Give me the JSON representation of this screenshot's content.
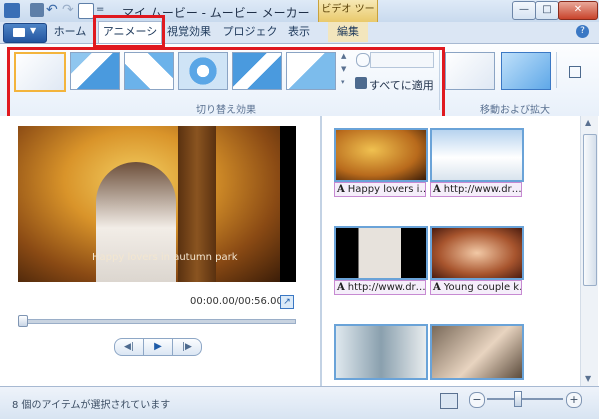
{
  "titlebar": {
    "title": "マイ ムービー - ムービー メーカー",
    "context_group": "ビデオ ツール"
  },
  "tabs": [
    {
      "id": "home",
      "label": "ホーム"
    },
    {
      "id": "animation",
      "label": "アニメーション"
    },
    {
      "id": "visual",
      "label": "視覚効果"
    },
    {
      "id": "project",
      "label": "プロジェクト"
    },
    {
      "id": "view",
      "label": "表示"
    },
    {
      "id": "edit",
      "label": "編集"
    }
  ],
  "ribbon": {
    "transitions_group_label": "切り替え効果",
    "apply_all_label": "すべてに適用",
    "panzoom_group_label": "移動および拡大",
    "duration_value": ""
  },
  "preview": {
    "overlay_caption": "Happy lovers in autumn park",
    "time_readout": "00:00.00/00:56.00"
  },
  "storyboard": {
    "captions": [
      "Happy lovers i…",
      "http://www.dr…",
      "http://www.dr…",
      "Young couple k…"
    ]
  },
  "status": {
    "text": "8 個のアイテムが選択されています"
  },
  "colors": {
    "highlight": "#e0191f",
    "clip_border": "#6aa3d8",
    "caption_border": "#c78ad2"
  }
}
